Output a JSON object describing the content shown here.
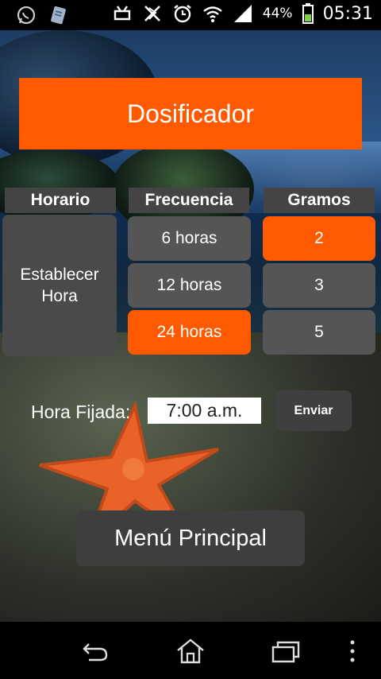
{
  "status_bar": {
    "left_icons": [
      "whatsapp-icon",
      "notification-icon"
    ],
    "right_icons": [
      "android-debug-icon",
      "bluetooth-off-icon",
      "alarm-icon",
      "wifi-icon",
      "signal-icon",
      "battery-icon"
    ],
    "battery_percent": "44%",
    "time": "05:31"
  },
  "app": {
    "title": "Dosificador",
    "columns": {
      "horario": "Horario",
      "frecuencia": "Frecuencia",
      "gramos": "Gramos"
    },
    "horario_button_line1": "Establecer",
    "horario_button_line2": "Hora",
    "frecuencia_options": [
      "6 horas",
      "12 horas",
      "24 horas"
    ],
    "frecuencia_selected": "24 horas",
    "gramos_options": [
      "2",
      "3",
      "5"
    ],
    "gramos_selected": "2",
    "hora_fijada_label": "Hora Fijada:",
    "hora_fijada_value": "7:00 a.m.",
    "enviar_label": "Enviar",
    "menu_principal_label": "Menú Principal",
    "accent_color": "#ff5a00",
    "button_color": "#555555"
  },
  "nav_bar": {
    "icons": [
      "back-icon",
      "home-icon",
      "recent-apps-icon",
      "overflow-menu-icon"
    ]
  }
}
